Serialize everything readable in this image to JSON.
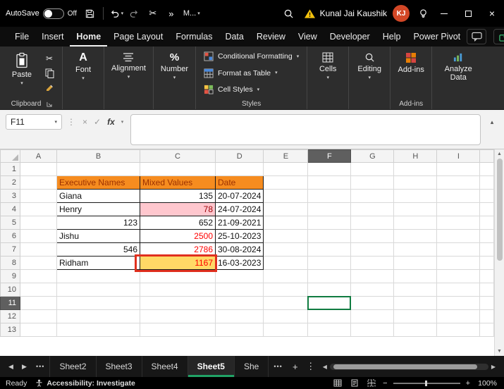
{
  "colors": {
    "header_fill": "#F68C1F",
    "header_text": "#9C3000",
    "negative_fill": "#FFC7CE",
    "negative_text": "#9C0006",
    "red_text": "#FF0000",
    "highlight_fill": "#FFD966",
    "highlight_border": "#E0301E",
    "selection_green": "#107C41",
    "active_tab_underline": "#21A366",
    "avatar_bg": "#D24726",
    "titlebar_bg": "#000000",
    "ribbon_bg": "#2D2D2D"
  },
  "glyphs": {
    "dropdown": "▾",
    "collapse": "▴",
    "cut": "✂",
    "more": "»",
    "kebab": "⋮",
    "close": "×",
    "cancel": "×",
    "enter": "✓",
    "plus": "+",
    "ellipsis": "•••",
    "left": "◀",
    "right": "▶",
    "up": "▲",
    "down": "▼",
    "minus": "−",
    "font_icon": "A",
    "percent": "%"
  },
  "title_bar": {
    "autosave_label": "AutoSave",
    "autosave_state": "Off",
    "more_commands": "M...",
    "alert_name": "Kunal Jai Kaushik",
    "avatar_initials": "KJ"
  },
  "menu_bar": {
    "tabs": [
      "File",
      "Insert",
      "Home",
      "Page Layout",
      "Formulas",
      "Data",
      "Review",
      "View",
      "Developer",
      "Help",
      "Power Pivot"
    ],
    "active_tab": "Home"
  },
  "ribbon": {
    "paste": "Paste",
    "clipboard_group": "Clipboard",
    "font": "Font",
    "alignment": "Alignment",
    "number": "Number",
    "conditional_formatting": "Conditional Formatting",
    "format_as_table": "Format as Table",
    "cell_styles": "Cell Styles",
    "styles_group": "Styles",
    "cells": "Cells",
    "editing": "Editing",
    "addins": "Add-ins",
    "addins_group": "Add-ins",
    "analyze_data": "Analyze Data"
  },
  "formula_bar": {
    "name_box": "F11",
    "fx_label": "fx",
    "formula_value": ""
  },
  "sheet": {
    "columns": [
      "A",
      "B",
      "C",
      "D",
      "E",
      "F",
      "G",
      "H",
      "I"
    ],
    "rows": 13,
    "selected": "F11",
    "cells": {
      "B2": {
        "t": "Executive Names",
        "s": "hdr"
      },
      "C2": {
        "t": "Mixed Values",
        "s": "hdr"
      },
      "D2": {
        "t": "Date",
        "s": "hdr"
      },
      "B3": {
        "t": "Giana",
        "s": "txt"
      },
      "C3": {
        "t": "135",
        "s": "num"
      },
      "D3": {
        "t": "20-07-2024",
        "s": "num"
      },
      "B4": {
        "t": "Henry",
        "s": "txt"
      },
      "C4": {
        "t": "78",
        "s": "neg"
      },
      "D4": {
        "t": "24-07-2024",
        "s": "num"
      },
      "B5": {
        "t": "123",
        "s": "num"
      },
      "C5": {
        "t": "652",
        "s": "num"
      },
      "D5": {
        "t": "21-09-2021",
        "s": "num"
      },
      "B6": {
        "t": "Jishu",
        "s": "txt"
      },
      "C6": {
        "t": "2500",
        "s": "red"
      },
      "D6": {
        "t": "25-10-2023",
        "s": "num"
      },
      "B7": {
        "t": "546",
        "s": "num"
      },
      "C7": {
        "t": "2786",
        "s": "red"
      },
      "D7": {
        "t": "30-08-2024",
        "s": "num"
      },
      "B8": {
        "t": "Ridham",
        "s": "txt"
      },
      "C8": {
        "t": "1167",
        "s": "hl",
        "box": true
      },
      "D8": {
        "t": "16-03-2023",
        "s": "num"
      }
    }
  },
  "sheet_tabs": {
    "tabs": [
      "Sheet2",
      "Sheet3",
      "Sheet4",
      "Sheet5",
      "She"
    ],
    "active": "Sheet5"
  },
  "status_bar": {
    "mode": "Ready",
    "accessibility": "Accessibility: Investigate",
    "zoom": "100%"
  }
}
